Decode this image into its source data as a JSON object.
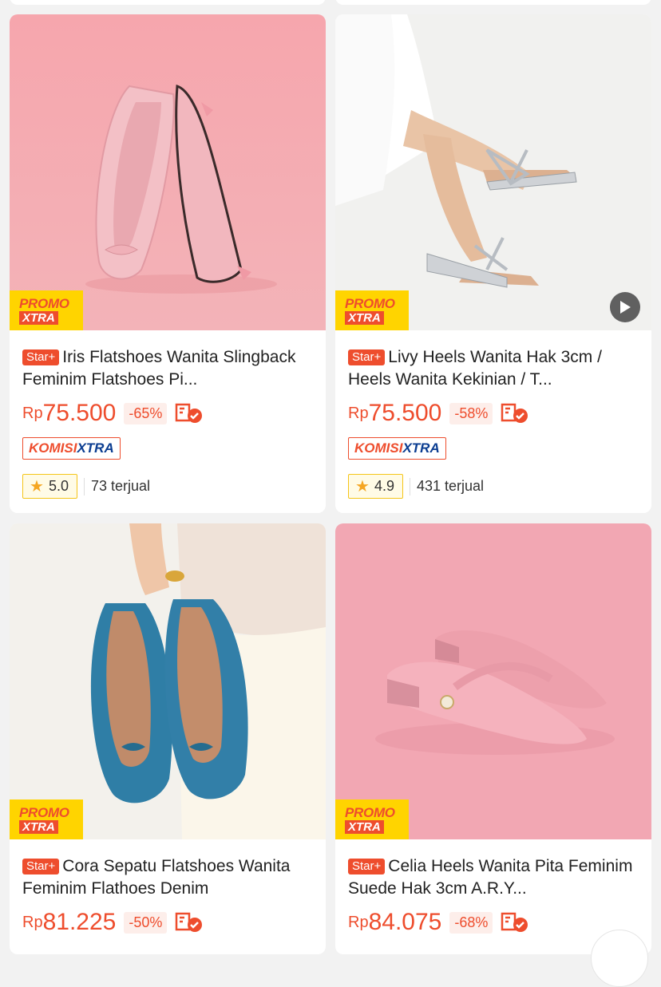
{
  "products": [
    {
      "title": "Iris Flatshoes Wanita Slingback Feminim Flatshoes Pi...",
      "badge": "Star+",
      "currency": "Rp",
      "price": "75.500",
      "discount": "-65%",
      "promo_line1": "PROMO",
      "promo_line2": "XTRA",
      "komisi_1": "KOMISI",
      "komisi_2": "XTRA",
      "rating": "5.0",
      "sold": "73 terjual",
      "image": "pink-slingback-flats"
    },
    {
      "title": "Livy Heels Wanita Hak 3cm / Heels Wanita Kekinian / T...",
      "badge": "Star+",
      "currency": "Rp",
      "price": "75.500",
      "discount": "-58%",
      "promo_line1": "PROMO",
      "promo_line2": "XTRA",
      "komisi_1": "KOMISI",
      "komisi_2": "XTRA",
      "rating": "4.9",
      "sold": "431 terjual",
      "image": "silver-bow-heels",
      "has_video": true
    },
    {
      "title": "Cora Sepatu Flatshoes Wanita Feminim Flathoes Denim",
      "badge": "Star+",
      "currency": "Rp",
      "price": "81.225",
      "discount": "-50%",
      "promo_line1": "PROMO",
      "promo_line2": "XTRA",
      "image": "blue-denim-flats"
    },
    {
      "title": "Celia Heels Wanita Pita Feminim Suede Hak 3cm A.R.Y...",
      "badge": "Star+",
      "currency": "Rp",
      "price": "84.075",
      "discount": "-68%",
      "promo_line1": "PROMO",
      "promo_line2": "XTRA",
      "image": "pink-suede-mules"
    }
  ],
  "colors": {
    "accent": "#ee4d2d",
    "promo_yellow": "#ffd400",
    "komisi_blue": "#0b3d91"
  }
}
